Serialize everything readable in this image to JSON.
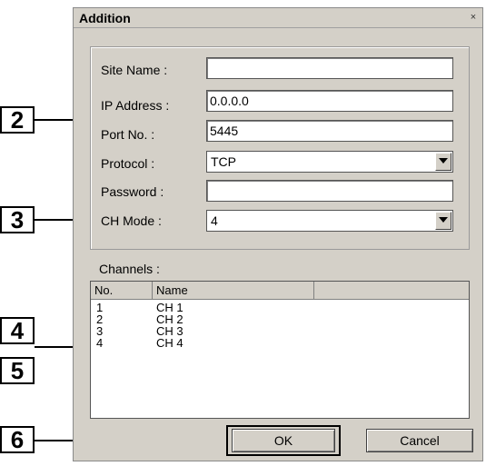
{
  "dialog": {
    "title": "Addition",
    "close_label": "×",
    "fields": {
      "site_name": {
        "label": "Site Name :",
        "value": ""
      },
      "ip_address": {
        "label": "IP Address :",
        "value": "0.0.0.0"
      },
      "port_no": {
        "label": "Port No. :",
        "value": "5445"
      },
      "protocol": {
        "label": "Protocol :",
        "value": "TCP"
      },
      "password": {
        "label": "Password :",
        "value": ""
      },
      "ch_mode": {
        "label": "CH Mode :",
        "value": "4"
      }
    },
    "channels": {
      "label": "Channels :",
      "columns": [
        "No.",
        "Name"
      ],
      "rows": [
        {
          "no": "1",
          "name": "CH 1"
        },
        {
          "no": "2",
          "name": "CH 2"
        },
        {
          "no": "3",
          "name": "CH 3"
        },
        {
          "no": "4",
          "name": "CH 4"
        }
      ]
    },
    "buttons": {
      "ok": "OK",
      "cancel": "Cancel"
    }
  },
  "callouts": [
    "2",
    "3",
    "4",
    "5",
    "6"
  ]
}
